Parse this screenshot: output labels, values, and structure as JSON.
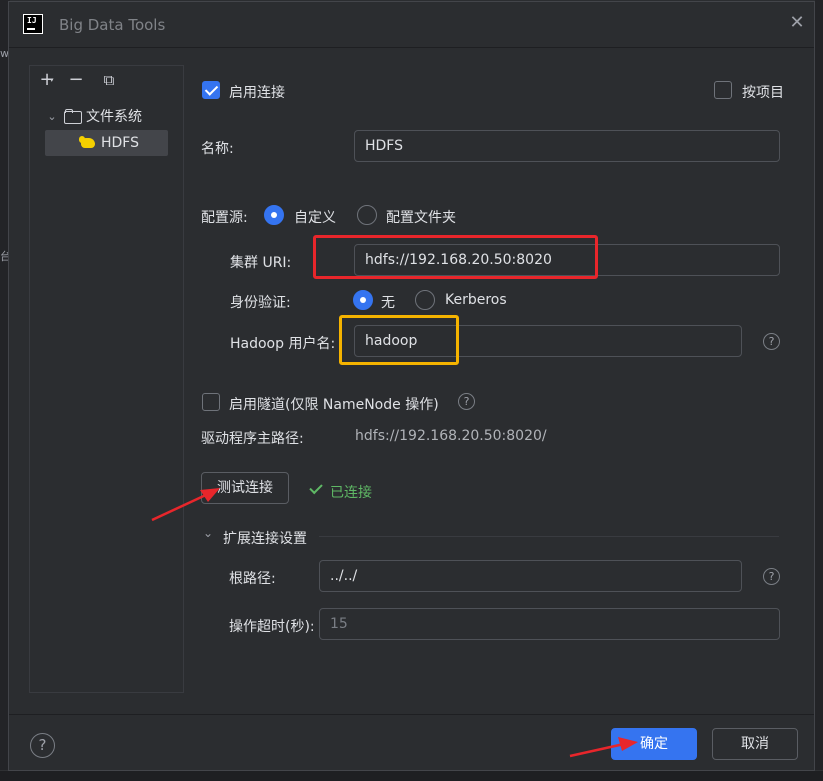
{
  "window": {
    "title": "Big Data Tools",
    "close_glyph": "✕",
    "logo_text": "IJ"
  },
  "background": {
    "edge_chars": [
      "wo",
      "台"
    ]
  },
  "tree": {
    "toolbar": {
      "add_glyph": "+",
      "add_caret": "▾",
      "remove_glyph": "−",
      "copy_glyph": "⧉"
    },
    "folder_label": "文件系统",
    "item_label": "HDFS"
  },
  "form": {
    "enable_connection_label": "启用连接",
    "enable_connection_checked": true,
    "per_project_label": "按项目",
    "per_project_checked": false,
    "name_label": "名称:",
    "name_value": "HDFS",
    "config_source_label": "配置源:",
    "config_source_options": [
      "自定义",
      "配置文件夹"
    ],
    "config_source_selected": "自定义",
    "cluster_uri_label": "集群 URI:",
    "cluster_uri_value": "hdfs://192.168.20.50:8020",
    "auth_label": "身份验证:",
    "auth_options": [
      "无",
      "Kerberos"
    ],
    "auth_selected": "无",
    "hadoop_user_label": "Hadoop 用户名:",
    "hadoop_user_value": "hadoop",
    "tunnel_label": "启用隧道(仅限 NameNode 操作)",
    "tunnel_checked": false,
    "driver_path_label": "驱动程序主路径:",
    "driver_path_value": "hdfs://192.168.20.50:8020/",
    "test_button_label": "测试连接",
    "connected_status": "已连接",
    "extended_section_label": "扩展连接设置",
    "root_path_label": "根路径:",
    "root_path_value": "../../",
    "timeout_label": "操作超时(秒):",
    "timeout_placeholder": "15",
    "help_glyph": "?"
  },
  "footer": {
    "help_glyph": "?",
    "ok_label": "确定",
    "cancel_label": "取消"
  },
  "colors": {
    "accent": "#3574f0",
    "highlight_red": "#e8262b",
    "highlight_yellow": "#f5b300",
    "success": "#5fb865"
  }
}
